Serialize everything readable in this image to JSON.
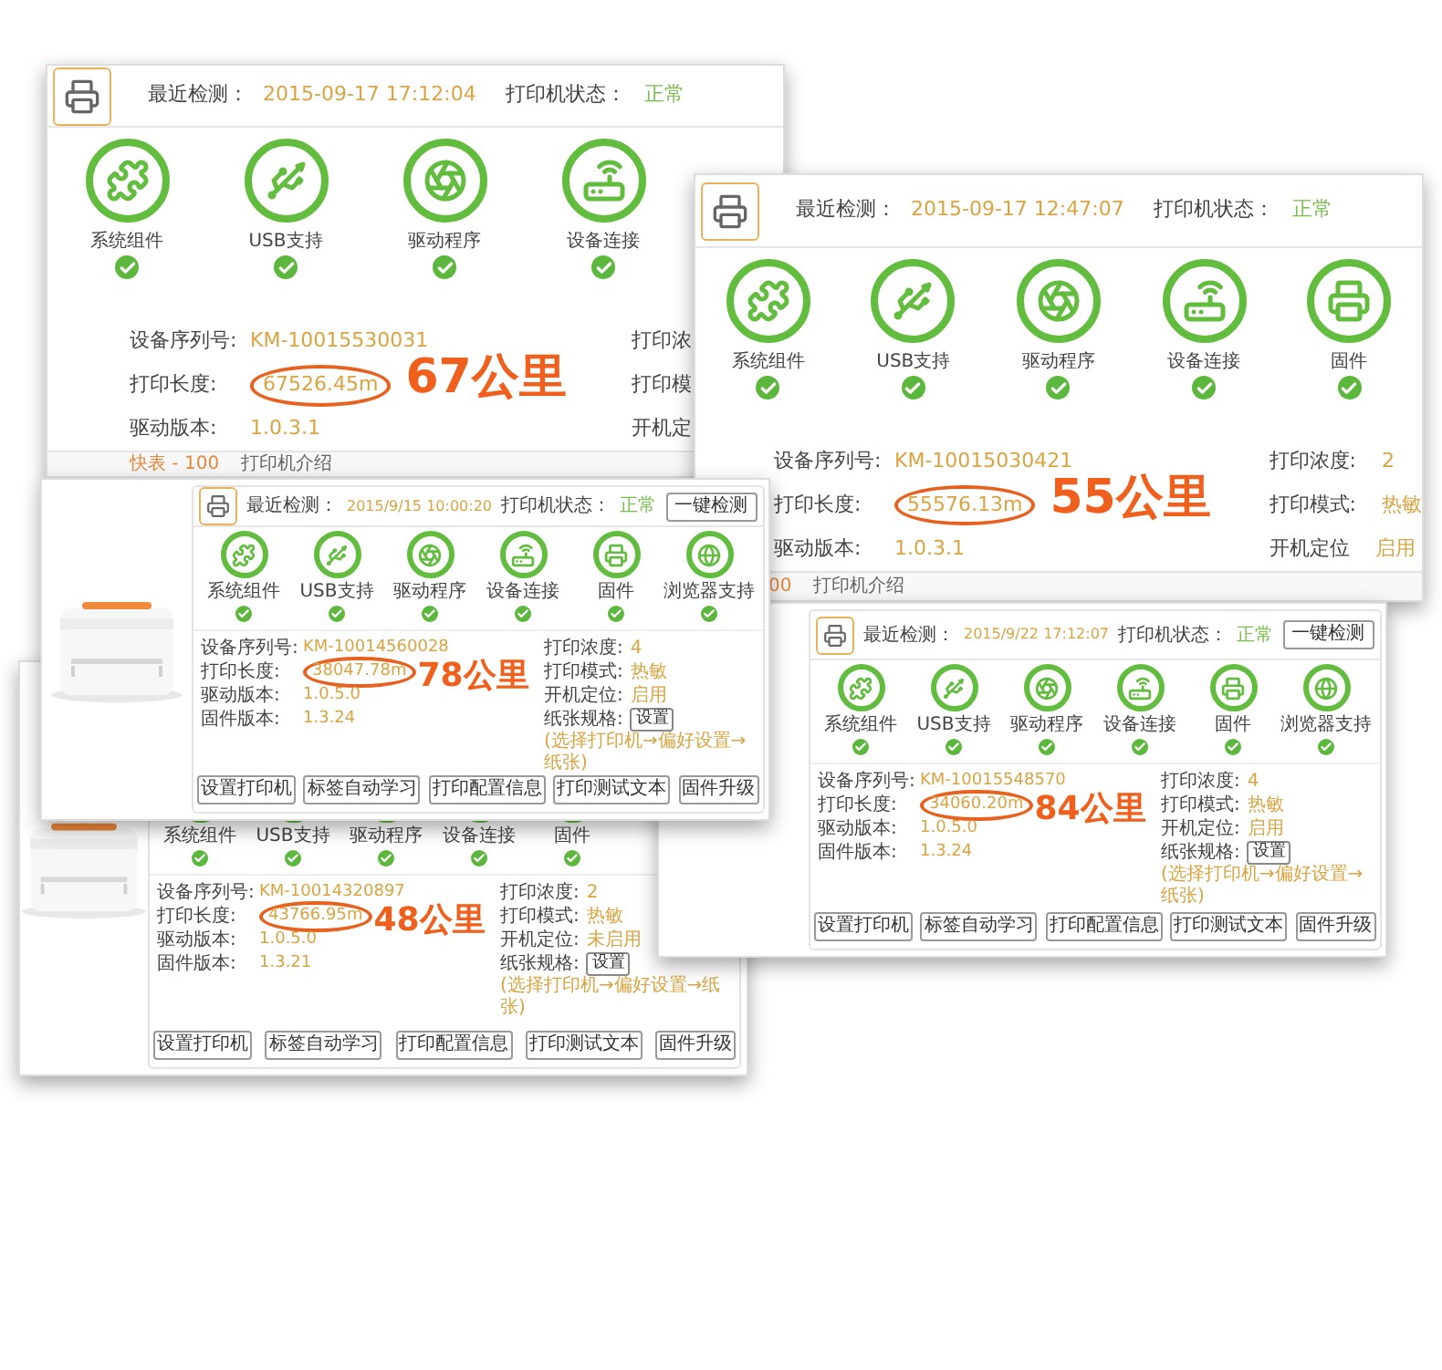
{
  "windows": [
    {
      "kind": "large",
      "header": {
        "check_label": "最近检测：",
        "check_time": "2015-09-17 17:12:04",
        "status_label": "打印机状态：",
        "status": "正常"
      },
      "components": [
        {
          "kind": "puzzle",
          "label": "系统组件"
        },
        {
          "kind": "usb",
          "label": "USB支持"
        },
        {
          "kind": "wheel",
          "label": "驱动程序"
        },
        {
          "kind": "router",
          "label": "设备连接"
        }
      ],
      "info_left": [
        {
          "label": "设备序列号:",
          "value": "KM-10015530031",
          "circled": false
        },
        {
          "label": "打印长度:",
          "value": "67526.45m",
          "circled": true,
          "note": "67公里"
        },
        {
          "label": "驱动版本:",
          "value": "1.0.3.1",
          "circled": false
        }
      ],
      "info_right": [
        {
          "label": "打印浓"
        },
        {
          "label": "打印模"
        },
        {
          "label": "开机定"
        }
      ],
      "footer": [
        {
          "text": "快表 - 100",
          "color": "#e8873a"
        },
        {
          "text": "打印机介绍",
          "color": "#666666"
        }
      ]
    },
    {
      "kind": "large",
      "header": {
        "check_label": "最近检测：",
        "check_time": "2015-09-17 12:47:07",
        "status_label": "打印机状态：",
        "status": "正常"
      },
      "components": [
        {
          "kind": "puzzle",
          "label": "系统组件"
        },
        {
          "kind": "usb",
          "label": "USB支持"
        },
        {
          "kind": "wheel",
          "label": "驱动程序"
        },
        {
          "kind": "router",
          "label": "设备连接"
        },
        {
          "kind": "printer",
          "label": "固件"
        }
      ],
      "info_left": [
        {
          "label": "设备序列号:",
          "value": "KM-10015030421",
          "circled": false
        },
        {
          "label": "打印长度:",
          "value": "55576.13m",
          "circled": true,
          "note": "55公里"
        },
        {
          "label": "驱动版本:",
          "value": "1.0.3.1",
          "circled": false
        }
      ],
      "info_right": [
        {
          "label": "打印浓度:",
          "value": "2"
        },
        {
          "label": "打印模式:",
          "value": "热敏"
        },
        {
          "label": "开机定位",
          "value": "启用"
        }
      ],
      "footer": [
        {
          "text": "00",
          "color": "#e8873a"
        },
        {
          "text": "打印机介绍",
          "color": "#666666"
        }
      ]
    },
    {
      "kind": "small",
      "product_image": {
        "kind": "picture"
      },
      "header": {
        "check_label": "最近检测：",
        "check_time": "2015/9/15 10:00:20",
        "status_label": "打印机状态：",
        "status": "正常",
        "detect_button": "一键检测"
      },
      "components": [
        {
          "kind": "puzzle",
          "label": "系统组件"
        },
        {
          "kind": "usb",
          "label": "USB支持"
        },
        {
          "kind": "wheel",
          "label": "驱动程序"
        },
        {
          "kind": "router",
          "label": "设备连接"
        },
        {
          "kind": "printer",
          "label": "固件"
        },
        {
          "kind": "browser",
          "label": "浏览器支持"
        }
      ],
      "info_left": [
        {
          "label": "设备序列号:",
          "value": "KM-10014560028",
          "circled": false
        },
        {
          "label": "打印长度:",
          "value": "38047.78m",
          "circled": true,
          "note": "78公里"
        },
        {
          "label": "驱动版本:",
          "value": "1.0.5.0",
          "circled": false
        },
        {
          "label": "固件版本:",
          "value": "1.3.24",
          "circled": false
        }
      ],
      "info_right": [
        {
          "label": "打印浓度:",
          "value": "4"
        },
        {
          "label": "打印模式:",
          "value": "热敏"
        },
        {
          "label": "开机定位:",
          "value": "启用"
        },
        {
          "label": "纸张规格:",
          "setting_button": "设置",
          "hint": "(选择打印机→偏好设置→纸张)"
        }
      ],
      "buttons": [
        "设置打印机",
        "标签自动学习",
        "打印配置信息",
        "打印测试文本",
        "固件升级"
      ]
    },
    {
      "kind": "small",
      "header": {
        "check_label": "最近检测：",
        "check_time": "2015/9/22 17:12:07",
        "status_label": "打印机状态：",
        "status": "正常",
        "detect_button": "一键检测"
      },
      "components": [
        {
          "kind": "puzzle",
          "label": "系统组件"
        },
        {
          "kind": "usb",
          "label": "USB支持"
        },
        {
          "kind": "wheel",
          "label": "驱动程序"
        },
        {
          "kind": "router",
          "label": "设备连接"
        },
        {
          "kind": "printer",
          "label": "固件"
        },
        {
          "kind": "browser",
          "label": "浏览器支持"
        }
      ],
      "info_left": [
        {
          "label": "设备序列号:",
          "value": "KM-10015548570",
          "circled": false
        },
        {
          "label": "打印长度:",
          "value": "34060.20m",
          "circled": true,
          "note": "84公里"
        },
        {
          "label": "驱动版本:",
          "value": "1.0.5.0",
          "circled": false
        },
        {
          "label": "固件版本:",
          "value": "1.3.24",
          "circled": false
        }
      ],
      "info_right": [
        {
          "label": "打印浓度:",
          "value": "4"
        },
        {
          "label": "打印模式:",
          "value": "热敏"
        },
        {
          "label": "开机定位:",
          "value": "启用"
        },
        {
          "label": "纸张规格:",
          "setting_button": "设置",
          "hint": "(选择打印机→偏好设置→纸张)"
        }
      ],
      "buttons": [
        "设置打印机",
        "标签自动学习",
        "打印配置信息",
        "打印测试文本",
        "固件升级"
      ]
    },
    {
      "kind": "small",
      "product_image": {
        "kind": "picture"
      },
      "components": [
        {
          "kind": "puzzle",
          "label": "系统组件"
        },
        {
          "kind": "usb",
          "label": "USB支持"
        },
        {
          "kind": "wheel",
          "label": "驱动程序"
        },
        {
          "kind": "router",
          "label": "设备连接"
        },
        {
          "kind": "printer",
          "label": "固件"
        }
      ],
      "info_left": [
        {
          "label": "设备序列号:",
          "value": "KM-10014320897",
          "circled": false
        },
        {
          "label": "打印长度:",
          "value": "43766.95m",
          "circled": true,
          "note": "48公里"
        },
        {
          "label": "驱动版本:",
          "value": "1.0.5.0",
          "circled": false
        },
        {
          "label": "固件版本:",
          "value": "1.3.21",
          "circled": false
        }
      ],
      "info_right": [
        {
          "label": "打印浓度:",
          "value": "2"
        },
        {
          "label": "打印模式:",
          "value": "热敏"
        },
        {
          "label": "开机定位:",
          "value": "未启用"
        },
        {
          "label": "纸张规格:",
          "setting_button": "设置",
          "hint": "(选择打印机→偏好设置→纸张)"
        }
      ],
      "buttons": [
        "设置打印机",
        "标签自动学习",
        "打印配置信息",
        "打印测试文本",
        "固件升级"
      ]
    }
  ]
}
